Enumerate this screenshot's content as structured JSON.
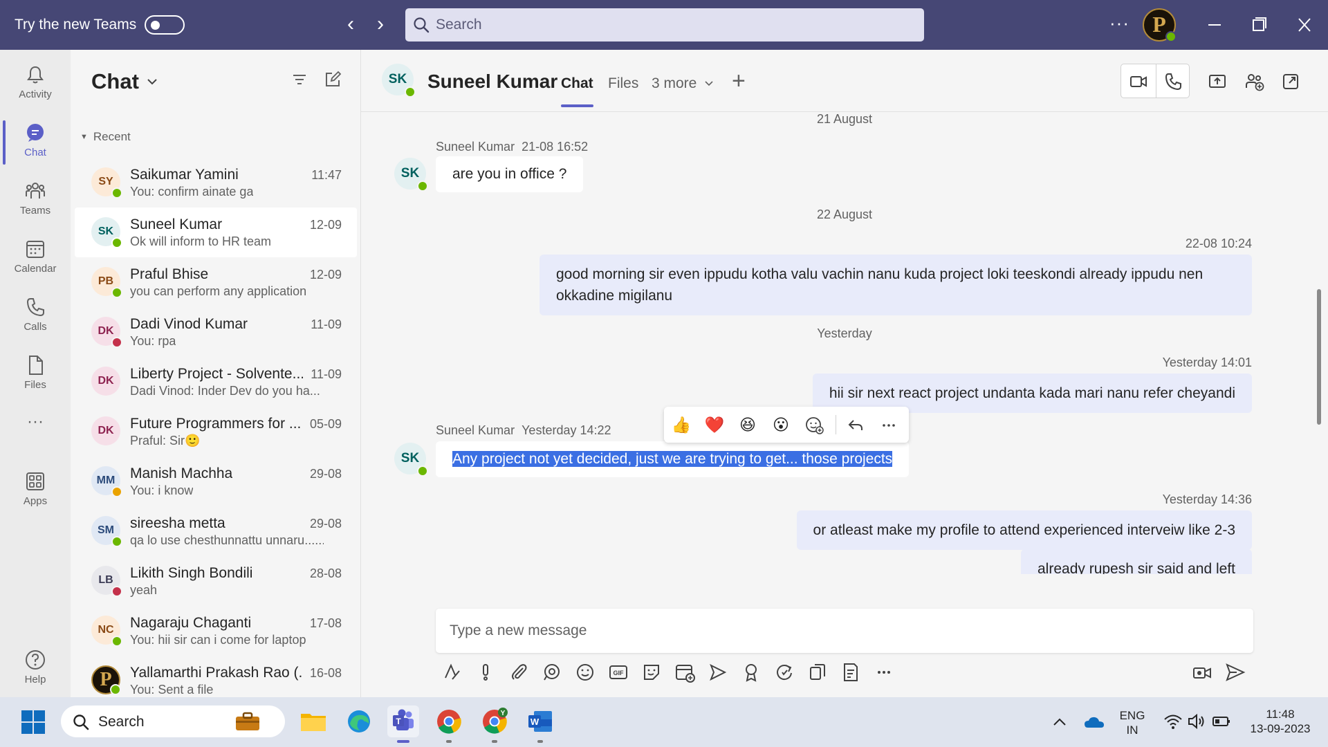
{
  "titlebar": {
    "try_label": "Try the new Teams",
    "search_placeholder": "Search",
    "more_label": "···"
  },
  "rail": {
    "items": [
      {
        "label": "Activity",
        "icon": "bell-icon"
      },
      {
        "label": "Chat",
        "icon": "chat-icon"
      },
      {
        "label": "Teams",
        "icon": "teams-icon"
      },
      {
        "label": "Calendar",
        "icon": "calendar-icon"
      },
      {
        "label": "Calls",
        "icon": "phone-icon"
      },
      {
        "label": "Files",
        "icon": "file-icon"
      },
      {
        "label": "···",
        "icon": "more-icon"
      },
      {
        "label": "Apps",
        "icon": "apps-icon"
      },
      {
        "label": "Help",
        "icon": "help-icon"
      }
    ]
  },
  "chatlist": {
    "title": "Chat",
    "section": "Recent",
    "chats": [
      {
        "initials": "SY",
        "name": "Saikumar Yamini",
        "preview": "You: confirm ainate ga",
        "time": "11:47",
        "avatar_bg": "#fcead8",
        "avatar_fg": "#8a4a16",
        "presence": "#6bb700"
      },
      {
        "initials": "SK",
        "name": "Suneel Kumar",
        "preview": "Ok will inform to HR team",
        "time": "12-09",
        "avatar_bg": "#e3f0f1",
        "avatar_fg": "#00605e",
        "presence": "#6bb700"
      },
      {
        "initials": "PB",
        "name": "Praful Bhise",
        "preview": "you can perform any application",
        "time": "12-09",
        "avatar_bg": "#fcead8",
        "avatar_fg": "#8a4a16",
        "presence": "#6bb700"
      },
      {
        "initials": "DK",
        "name": "Dadi Vinod Kumar",
        "preview": "You: rpa",
        "time": "11-09",
        "avatar_bg": "#f6dfe8",
        "avatar_fg": "#8e2350",
        "presence": "#c4314b"
      },
      {
        "initials": "DK",
        "name": "Liberty Project - Solvente...",
        "preview": "Dadi Vinod: Inder Dev do you ha...",
        "time": "11-09",
        "avatar_bg": "#f6dfe8",
        "avatar_fg": "#8e2350",
        "presence": ""
      },
      {
        "initials": "DK",
        "name": "Future Programmers for ...",
        "preview": "Praful: Sir🙂",
        "time": "05-09",
        "avatar_bg": "#f6dfe8",
        "avatar_fg": "#8e2350",
        "presence": ""
      },
      {
        "initials": "MM",
        "name": "Manish Machha",
        "preview": "You: i know",
        "time": "29-08",
        "avatar_bg": "#e0e8f4",
        "avatar_fg": "#2b4a7a",
        "presence": "#eaa300"
      },
      {
        "initials": "SM",
        "name": "sireesha metta",
        "preview": "qa lo use chesthunnattu unnaru......",
        "time": "29-08",
        "avatar_bg": "#e0e8f4",
        "avatar_fg": "#2b4a7a",
        "presence": "#6bb700"
      },
      {
        "initials": "LB",
        "name": "Likith Singh Bondili",
        "preview": "yeah",
        "time": "28-08",
        "avatar_bg": "#e8e8ec",
        "avatar_fg": "#3b3b55",
        "presence": "#c4314b"
      },
      {
        "initials": "NC",
        "name": "Nagaraju Chaganti",
        "preview": "You: hii sir can i come for laptop",
        "time": "17-08",
        "avatar_bg": "#fcead8",
        "avatar_fg": "#8a4a16",
        "presence": "#6bb700"
      },
      {
        "initials": "P",
        "name": "Yallamarthi Prakash Rao (...",
        "preview": "You: Sent a file",
        "time": "16-08",
        "avatar_bg": "#1a1208",
        "avatar_fg": "#d5a850",
        "presence": "#6bb700"
      }
    ]
  },
  "header": {
    "initials": "SK",
    "name": "Suneel Kumar",
    "tabs": [
      "Chat",
      "Files",
      "3 more"
    ]
  },
  "messages": {
    "date1": "21 August",
    "m1_sender": "Suneel Kumar",
    "m1_time": "21-08 16:52",
    "m1_text": "are you in office ?",
    "date2": "22 August",
    "m2_time": "22-08 10:24",
    "m2_text": "good morning sir even ippudu kotha valu vachin nanu kuda project loki teeskondi already ippudu nen okkadine migilanu",
    "date3": "Yesterday",
    "m3_time": "Yesterday 14:01",
    "m3_text": "hii sir next react project undanta kada mari nanu refer cheyandi",
    "m4_sender": "Suneel Kumar",
    "m4_time": "Yesterday 14:22",
    "m4_text": "Any project not yet decided, just we are trying to get... those projects",
    "m5_time": "Yesterday 14:36",
    "m5_text": "or atleast make my profile to attend experienced interveiw like 2-3",
    "m6_text": "already rupesh sir said and left",
    "reactions": [
      "👍",
      "❤️",
      "😆",
      "😮"
    ]
  },
  "compose": {
    "placeholder": "Type a new message"
  },
  "taskbar": {
    "search_placeholder": "Search",
    "lang_top": "ENG",
    "lang_bottom": "IN",
    "time": "11:48",
    "date": "13-09-2023"
  },
  "colors": {
    "brand": "#5b5fc7",
    "titlebar": "#464775",
    "available": "#6bb700",
    "busy": "#c4314b",
    "away": "#eaa300"
  }
}
